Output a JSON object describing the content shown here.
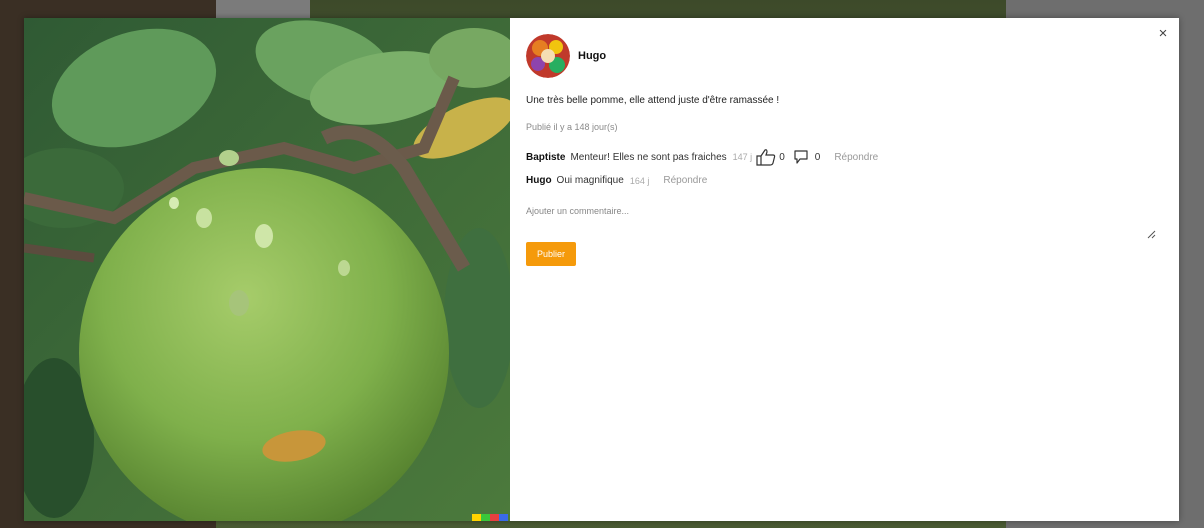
{
  "post": {
    "author": "Hugo",
    "caption": "Une très belle pomme, elle attend juste d'être ramassée !",
    "posted": "Publié il y a 148 jour(s)"
  },
  "comments": [
    {
      "author": "Baptiste",
      "text": "Menteur! Elles ne sont pas fraiches",
      "time": "147 j",
      "likes": "0",
      "dislikes": "0",
      "reply": "Répondre"
    },
    {
      "author": "Hugo",
      "text": "Oui magnifique",
      "time": "164 j",
      "reply": "Répondre"
    }
  ],
  "form": {
    "placeholder": "Ajouter un commentaire...",
    "submit": "Publier"
  },
  "close_label": "×",
  "colors": {
    "accent": "#f59a0b"
  },
  "icons": {
    "close": "close-icon",
    "like": "thumbs-up-icon",
    "dislike": "speech-bubble-icon",
    "resize": "resize-handle-icon"
  }
}
